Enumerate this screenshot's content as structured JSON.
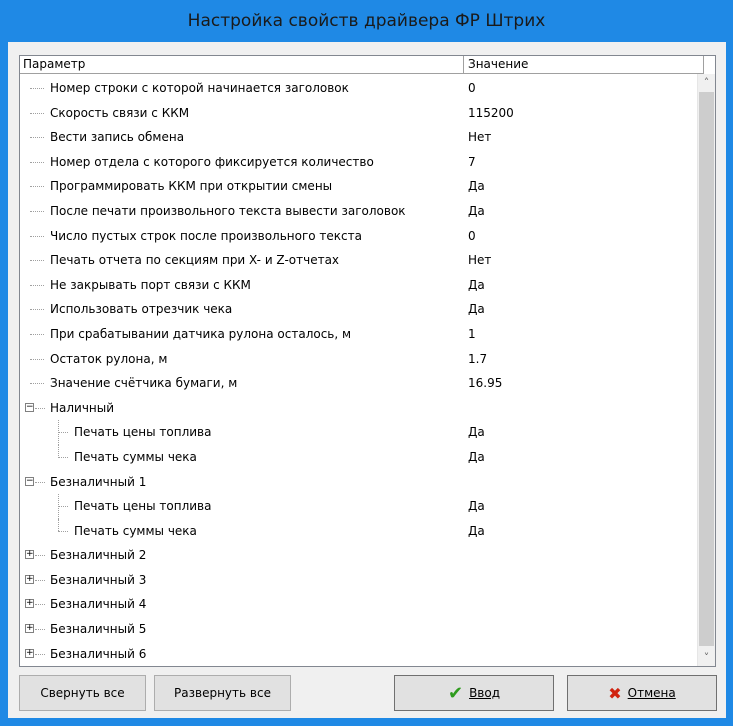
{
  "window": {
    "title": "Настройка свойств драйвера ФР Штрих"
  },
  "header": {
    "param": "Параметр",
    "value": "Значение"
  },
  "rows": [
    {
      "label": "Номер строки с которой начинается заголовок",
      "value": "0",
      "level": 0,
      "type": "leaf"
    },
    {
      "label": "Скорость связи с ККМ",
      "value": "115200",
      "level": 0,
      "type": "leaf"
    },
    {
      "label": "Вести запись обмена",
      "value": "Нет",
      "level": 0,
      "type": "leaf"
    },
    {
      "label": "Номер отдела с которого фиксируется количество",
      "value": "7",
      "level": 0,
      "type": "leaf"
    },
    {
      "label": "Программировать ККМ при открытии смены",
      "value": "Да",
      "level": 0,
      "type": "leaf"
    },
    {
      "label": "После печати произвольного текста вывести заголовок",
      "value": "Да",
      "level": 0,
      "type": "leaf"
    },
    {
      "label": "Число пустых строк после произвольного текста",
      "value": "0",
      "level": 0,
      "type": "leaf"
    },
    {
      "label": "Печать отчета по секциям при X- и Z-отчетах",
      "value": "Нет",
      "level": 0,
      "type": "leaf"
    },
    {
      "label": "Не закрывать порт связи с ККМ",
      "value": "Да",
      "level": 0,
      "type": "leaf"
    },
    {
      "label": "Использовать отрезчик чека",
      "value": "Да",
      "level": 0,
      "type": "leaf"
    },
    {
      "label": "При срабатывании датчика рулона осталось, м",
      "value": "1",
      "level": 0,
      "type": "leaf"
    },
    {
      "label": "Остаток рулона, м",
      "value": "1.7",
      "level": 0,
      "type": "leaf"
    },
    {
      "label": "Значение счётчика бумаги, м",
      "value": "16.95",
      "level": 0,
      "type": "leaf"
    },
    {
      "label": "Наличный",
      "value": "",
      "level": 0,
      "type": "group",
      "expanded": true
    },
    {
      "label": "Печать цены топлива",
      "value": "Да",
      "level": 1,
      "type": "leaf"
    },
    {
      "label": "Печать суммы чека",
      "value": "Да",
      "level": 1,
      "type": "leaf",
      "last": true
    },
    {
      "label": "Безналичный 1",
      "value": "",
      "level": 0,
      "type": "group",
      "expanded": true
    },
    {
      "label": "Печать цены топлива",
      "value": "Да",
      "level": 1,
      "type": "leaf"
    },
    {
      "label": "Печать суммы чека",
      "value": "Да",
      "level": 1,
      "type": "leaf",
      "last": true
    },
    {
      "label": "Безналичный 2",
      "value": "",
      "level": 0,
      "type": "group",
      "expanded": false
    },
    {
      "label": "Безналичный 3",
      "value": "",
      "level": 0,
      "type": "group",
      "expanded": false
    },
    {
      "label": "Безналичный 4",
      "value": "",
      "level": 0,
      "type": "group",
      "expanded": false
    },
    {
      "label": "Безналичный 5",
      "value": "",
      "level": 0,
      "type": "group",
      "expanded": false
    },
    {
      "label": "Безналичный 6",
      "value": "",
      "level": 0,
      "type": "group",
      "expanded": false
    }
  ],
  "buttons": {
    "collapse_all": "Свернуть все",
    "expand_all": "Развернуть все",
    "ok": "Ввод",
    "cancel": "Отмена"
  },
  "icons": {
    "ok": "checkmark-icon",
    "cancel": "cross-icon",
    "scroll_up": "chevron-up-icon",
    "scroll_down": "chevron-down-icon"
  },
  "colors": {
    "titlebar": "#1f89e5",
    "ok_icon": "#2e9b1d",
    "cancel_icon": "#d0220f"
  }
}
